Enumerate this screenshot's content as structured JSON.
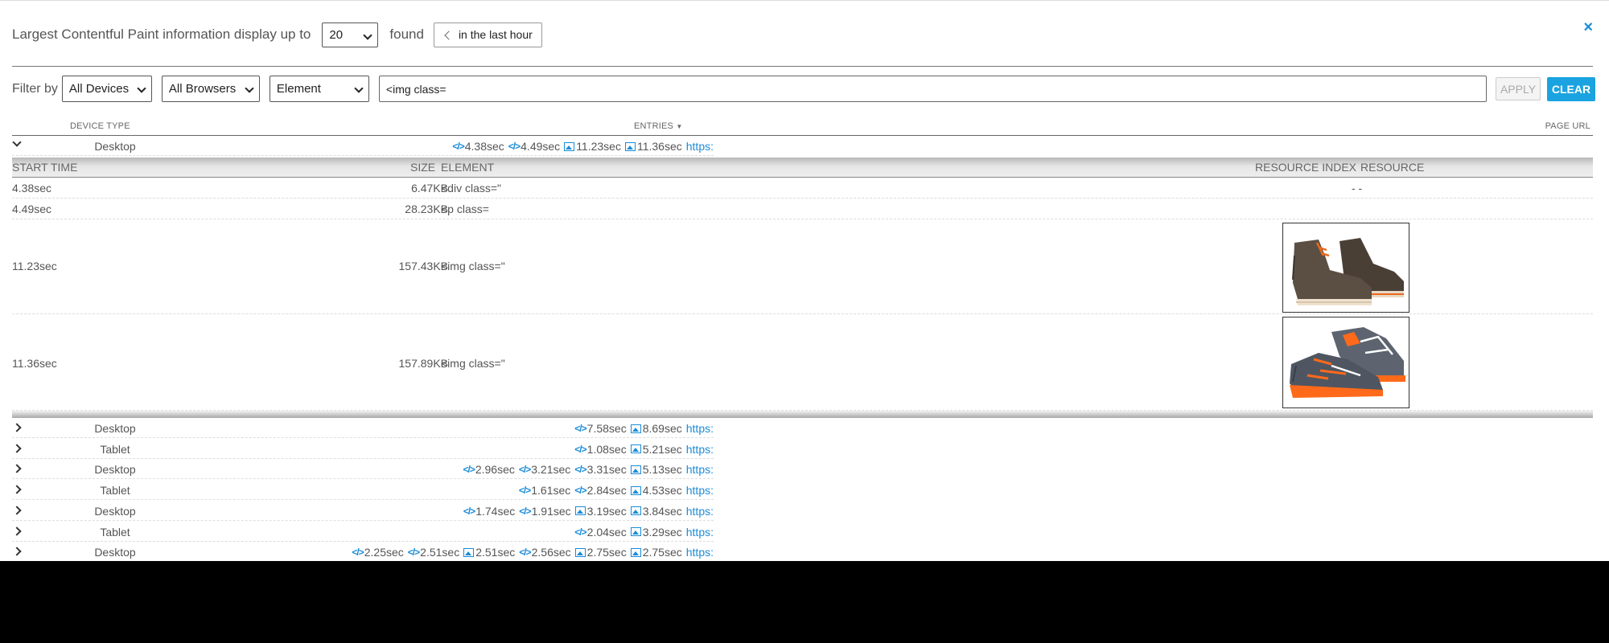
{
  "header": {
    "lead_label": "Largest Contentful Paint information display up to",
    "limit_value": "20",
    "found_label": "found",
    "time_range": "in the last hour",
    "close_label": "×"
  },
  "filter": {
    "label": "Filter by",
    "devices": "All Devices",
    "browsers": "All Browsers",
    "field": "Element",
    "query": "<img class=",
    "apply_label": "APPLY",
    "clear_label": "CLEAR"
  },
  "columns": {
    "device_type": "DEVICE TYPE",
    "entries": "ENTRIES",
    "page_url": "PAGE URL"
  },
  "expanded": {
    "device": "Desktop",
    "entries": [
      {
        "type": "code",
        "value": "4.38sec"
      },
      {
        "type": "code",
        "value": "4.49sec"
      },
      {
        "type": "img",
        "value": "11.23sec"
      },
      {
        "type": "img",
        "value": "11.36sec"
      }
    ],
    "url": "https:",
    "detail_headers": {
      "start_time": "START TIME",
      "size": "SIZE",
      "element": "ELEMENT",
      "resource_index": "RESOURCE INDEX",
      "resource": "RESOURCE"
    },
    "detail_rows": [
      {
        "start": "4.38sec",
        "size": "6.47KB",
        "element": "<div class=\"",
        "resource": "- -"
      },
      {
        "start": "4.49sec",
        "size": "28.23KB",
        "element": "<p class="
      },
      {
        "start": "11.23sec",
        "size": "157.43KB",
        "element": "<img class=\"",
        "image": "brown-suede-boot-image"
      },
      {
        "start": "11.36sec",
        "size": "157.89KB",
        "element": "<img class=\"",
        "image": "grey-orange-sneaker-image"
      }
    ]
  },
  "rows": [
    {
      "device": "Desktop",
      "entries": [
        {
          "type": "code",
          "value": "7.58sec"
        },
        {
          "type": "img",
          "value": "8.69sec"
        }
      ],
      "url": "https:"
    },
    {
      "device": "Tablet",
      "entries": [
        {
          "type": "code",
          "value": "1.08sec"
        },
        {
          "type": "img",
          "value": "5.21sec"
        }
      ],
      "url": "https:"
    },
    {
      "device": "Desktop",
      "entries": [
        {
          "type": "code",
          "value": "2.96sec"
        },
        {
          "type": "code",
          "value": "3.21sec"
        },
        {
          "type": "code",
          "value": "3.31sec"
        },
        {
          "type": "img",
          "value": "5.13sec"
        }
      ],
      "url": "https:"
    },
    {
      "device": "Tablet",
      "entries": [
        {
          "type": "code",
          "value": "1.61sec"
        },
        {
          "type": "code",
          "value": "2.84sec"
        },
        {
          "type": "img",
          "value": "4.53sec"
        }
      ],
      "url": "https:"
    },
    {
      "device": "Desktop",
      "entries": [
        {
          "type": "code",
          "value": "1.74sec"
        },
        {
          "type": "code",
          "value": "1.91sec"
        },
        {
          "type": "img",
          "value": "3.19sec"
        },
        {
          "type": "img",
          "value": "3.84sec"
        }
      ],
      "url": "https:"
    },
    {
      "device": "Tablet",
      "entries": [
        {
          "type": "code",
          "value": "2.04sec"
        },
        {
          "type": "img",
          "value": "3.29sec"
        }
      ],
      "url": "https:"
    },
    {
      "device": "Desktop",
      "entries": [
        {
          "type": "code",
          "value": "2.25sec"
        },
        {
          "type": "code",
          "value": "2.51sec"
        },
        {
          "type": "img",
          "value": "2.51sec"
        },
        {
          "type": "code",
          "value": "2.56sec"
        },
        {
          "type": "img",
          "value": "2.75sec"
        },
        {
          "type": "img",
          "value": "2.75sec"
        }
      ],
      "url": "https:"
    }
  ],
  "colors": {
    "accent": "#1a8cd8",
    "clear_button": "#1aa3e0"
  }
}
